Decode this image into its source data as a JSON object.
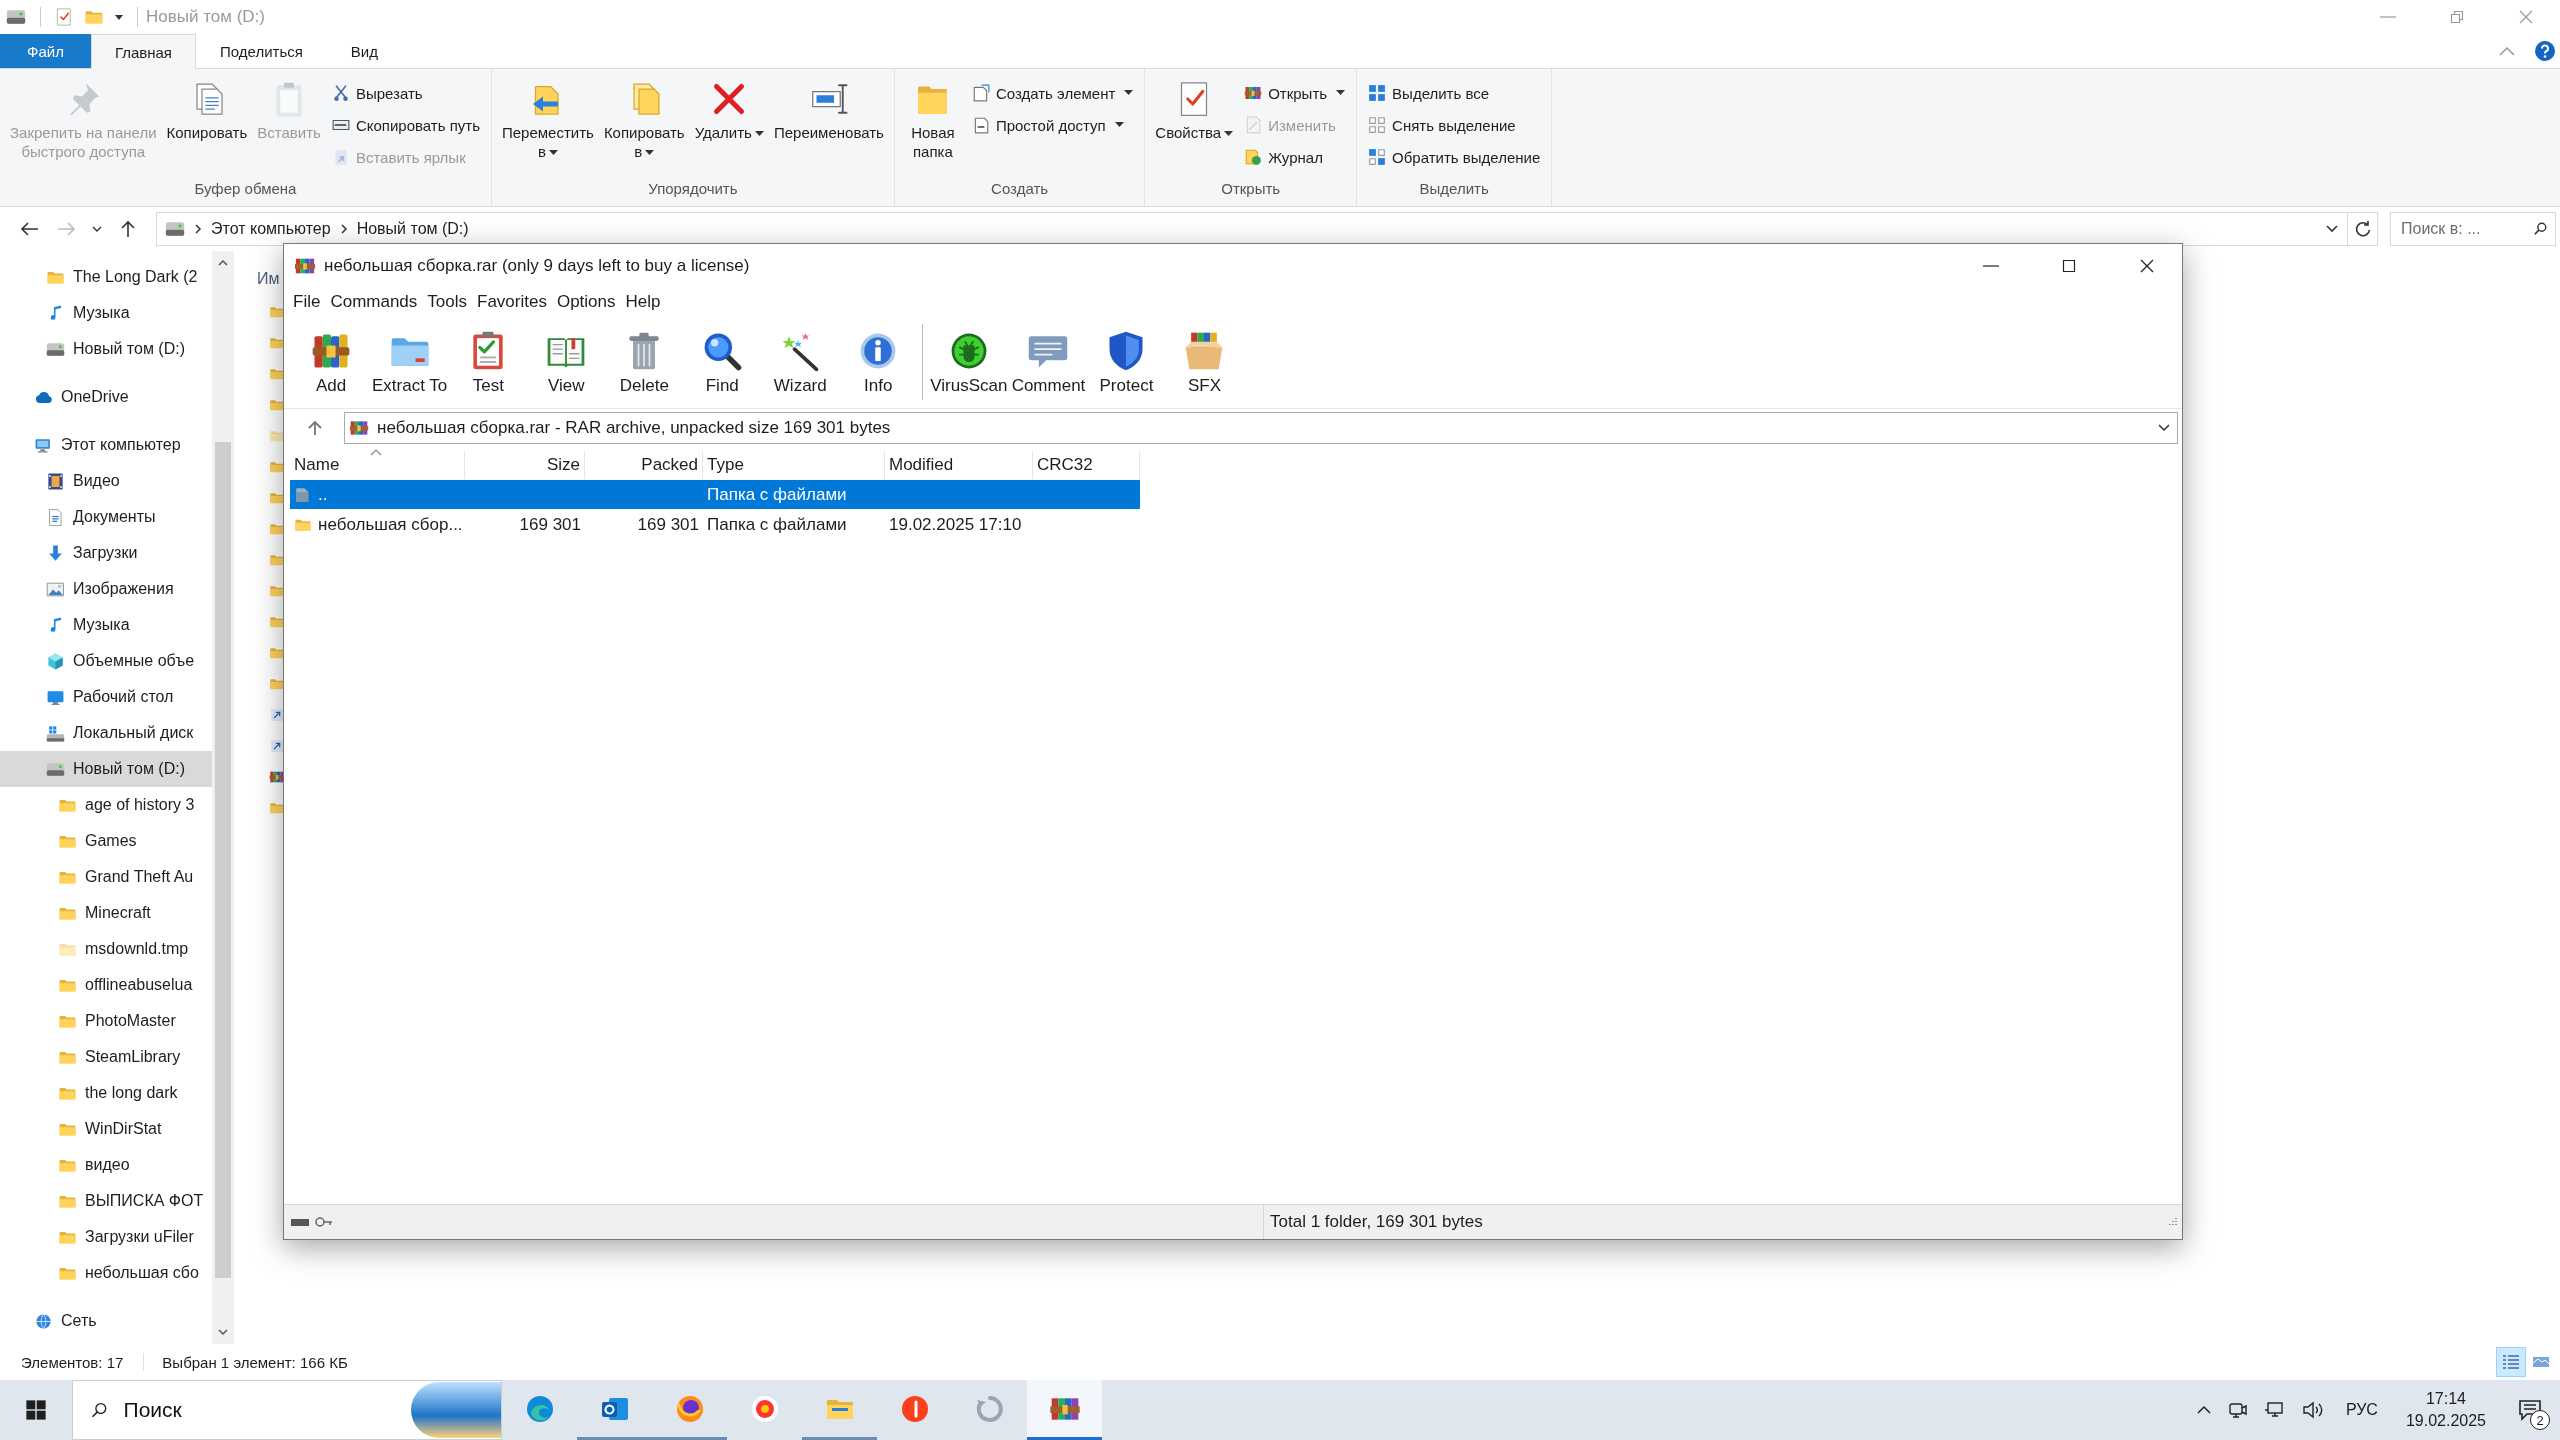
{
  "explorer": {
    "title": "Новый том (D:)",
    "ribbon_tabs": [
      {
        "label": "Файл",
        "kind": "file",
        "selected": false
      },
      {
        "label": "Главная",
        "kind": "tab",
        "selected": true
      },
      {
        "label": "Поделиться",
        "kind": "tab",
        "selected": false
      },
      {
        "label": "Вид",
        "kind": "tab",
        "selected": false
      }
    ],
    "ribbon_groups": [
      {
        "label": "Буфер обмена",
        "items": [
          {
            "kind": "large",
            "label": "Закрепить на панели\nбыстрого доступа",
            "disabled": true
          },
          {
            "kind": "large",
            "label": "Копировать",
            "disabled": false
          },
          {
            "kind": "large",
            "label": "Вставить",
            "disabled": true
          },
          {
            "kind": "stack",
            "items": [
              {
                "label": "Вырезать",
                "disabled": false
              },
              {
                "label": "Скопировать путь",
                "disabled": false
              },
              {
                "label": "Вставить ярлык",
                "disabled": true
              }
            ]
          }
        ]
      },
      {
        "label": "Упорядочить",
        "items": [
          {
            "kind": "large",
            "label": "Переместить\nв",
            "dropdown": true,
            "disabled": false
          },
          {
            "kind": "large",
            "label": "Копировать\nв",
            "dropdown": true,
            "disabled": false
          },
          {
            "kind": "large",
            "label": "Удалить",
            "dropdown": true,
            "disabled": false
          },
          {
            "kind": "large",
            "label": "Переименовать",
            "disabled": false
          }
        ]
      },
      {
        "label": "Создать",
        "items": [
          {
            "kind": "large",
            "label": "Новая\nпапка",
            "disabled": false
          },
          {
            "kind": "stack",
            "items": [
              {
                "label": "Создать элемент",
                "dropdown": true,
                "disabled": false
              },
              {
                "label": "Простой доступ",
                "dropdown": true,
                "disabled": false
              }
            ]
          }
        ]
      },
      {
        "label": "Открыть",
        "items": [
          {
            "kind": "large",
            "label": "Свойства",
            "dropdown": true,
            "disabled": false
          },
          {
            "kind": "stack",
            "items": [
              {
                "label": "Открыть",
                "dropdown": true,
                "disabled": false
              },
              {
                "label": "Изменить",
                "disabled": true
              },
              {
                "label": "Журнал",
                "disabled": false
              }
            ]
          }
        ]
      },
      {
        "label": "Выделить",
        "items": [
          {
            "kind": "stack",
            "items": [
              {
                "label": "Выделить все",
                "disabled": false
              },
              {
                "label": "Снять выделение",
                "disabled": false
              },
              {
                "label": "Обратить выделение",
                "disabled": false
              }
            ]
          }
        ]
      }
    ],
    "address": {
      "crumbs": [
        "Этот компьютер",
        "Новый том (D:)"
      ]
    },
    "search": {
      "placeholder": "Поиск в: ..."
    },
    "nav": {
      "quick_access": [
        {
          "label": "The Long Dark (2",
          "kind": "folder",
          "selected": false
        },
        {
          "label": "Музыка",
          "kind": "music",
          "selected": false
        },
        {
          "label": "Новый том (D:)",
          "kind": "drive",
          "selected": false
        }
      ],
      "items": [
        {
          "label": "OneDrive",
          "kind": "cloud",
          "selected": false
        },
        {
          "label": "Этот компьютер",
          "kind": "pc",
          "selected": false,
          "children": [
            {
              "label": "Видео",
              "kind": "video",
              "selected": false
            },
            {
              "label": "Документы",
              "kind": "docs",
              "selected": false
            },
            {
              "label": "Загрузки",
              "kind": "download",
              "selected": false
            },
            {
              "label": "Изображения",
              "kind": "images",
              "selected": false
            },
            {
              "label": "Музыка",
              "kind": "music",
              "selected": false
            },
            {
              "label": "Объемные объе",
              "kind": "cube",
              "selected": false
            },
            {
              "label": "Рабочий стол",
              "kind": "desktop",
              "selected": false
            },
            {
              "label": "Локальный диск",
              "kind": "localdisk",
              "selected": false
            },
            {
              "label": "Новый том (D:)",
              "kind": "drive",
              "selected": true,
              "children": [
                {
                  "label": "age of history 3",
                  "kind": "folder",
                  "selected": false
                },
                {
                  "label": "Games",
                  "kind": "folder",
                  "selected": false
                },
                {
                  "label": "Grand Theft Au",
                  "kind": "folder",
                  "selected": false
                },
                {
                  "label": "Minecraft",
                  "kind": "folder",
                  "selected": false
                },
                {
                  "label": "msdownld.tmp",
                  "kind": "hidden_folder",
                  "selected": false
                },
                {
                  "label": "offlineabuselua",
                  "kind": "folder",
                  "selected": false
                },
                {
                  "label": "PhotoMaster",
                  "kind": "folder",
                  "selected": false
                },
                {
                  "label": "SteamLibrary",
                  "kind": "folder",
                  "selected": false
                },
                {
                  "label": "the long dark",
                  "kind": "folder",
                  "selected": false
                },
                {
                  "label": "WinDirStat",
                  "kind": "folder",
                  "selected": false
                },
                {
                  "label": "видео",
                  "kind": "folder",
                  "selected": false
                },
                {
                  "label": "ВЫПИСКА ФОТ",
                  "kind": "folder",
                  "selected": false
                },
                {
                  "label": "Загрузки uFiler",
                  "kind": "folder",
                  "selected": false
                },
                {
                  "label": "небольшая сбо",
                  "kind": "folder",
                  "selected": false
                }
              ]
            }
          ]
        },
        {
          "label": "Сеть",
          "kind": "network",
          "selected": false
        }
      ]
    },
    "content": {
      "column_1": "Им",
      "rows": [
        {
          "kind": "folder"
        },
        {
          "kind": "folder"
        },
        {
          "kind": "folder"
        },
        {
          "kind": "folder"
        },
        {
          "kind": "hidden_folder"
        },
        {
          "kind": "folder"
        },
        {
          "kind": "folder"
        },
        {
          "kind": "folder"
        },
        {
          "kind": "folder"
        },
        {
          "kind": "folder"
        },
        {
          "kind": "folder"
        },
        {
          "kind": "folder"
        },
        {
          "kind": "folder"
        },
        {
          "kind": "shortcut"
        },
        {
          "kind": "shortcut"
        },
        {
          "kind": "archive"
        },
        {
          "kind": "folder"
        }
      ]
    },
    "status": {
      "item_count": "Элементов: 17",
      "selection": "Выбран 1 элемент: 166 КБ",
      "view_buttons": [
        {
          "selected": true
        },
        {
          "selected": false
        }
      ]
    }
  },
  "winrar": {
    "title": "небольшая сборка.rar (only 9 days left to buy a license)",
    "menu": [
      "File",
      "Commands",
      "Tools",
      "Favorites",
      "Options",
      "Help"
    ],
    "toolbar": [
      {
        "label": "Add"
      },
      {
        "label": "Extract To"
      },
      {
        "label": "Test"
      },
      {
        "label": "View"
      },
      {
        "label": "Delete"
      },
      {
        "label": "Find"
      },
      {
        "label": "Wizard"
      },
      {
        "label": "Info"
      },
      {
        "label": "VirusScan"
      },
      {
        "label": "Comment"
      },
      {
        "label": "Protect"
      },
      {
        "label": "SFX"
      }
    ],
    "path": "небольшая сборка.rar - RAR archive, unpacked size 169 301 bytes",
    "columns": [
      "Name",
      "Size",
      "Packed",
      "Type",
      "Modified",
      "CRC32"
    ],
    "rows": [
      {
        "kind": "up",
        "name": "..",
        "type": "Папка с файлами",
        "selected": true
      },
      {
        "kind": "folder",
        "name": "небольшая сбор...",
        "size": "169 301",
        "packed": "169 301",
        "type": "Папка с файлами",
        "modified": "19.02.2025 17:10",
        "selected": false
      }
    ],
    "status": "Total 1 folder, 169 301 bytes"
  },
  "taskbar": {
    "search": {
      "placeholder": "Поиск"
    },
    "apps": [
      {
        "running": false,
        "selected": false
      },
      {
        "running": true,
        "selected": false
      },
      {
        "running": true,
        "selected": false
      },
      {
        "running": false,
        "selected": false
      },
      {
        "running": true,
        "selected": false
      },
      {
        "running": false,
        "selected": false
      },
      {
        "running": false,
        "selected": false
      },
      {
        "running": true,
        "selected": true
      }
    ],
    "tray": {
      "language": "РУС",
      "time": "17:14",
      "date": "19.02.2025",
      "notifications": "2"
    }
  }
}
